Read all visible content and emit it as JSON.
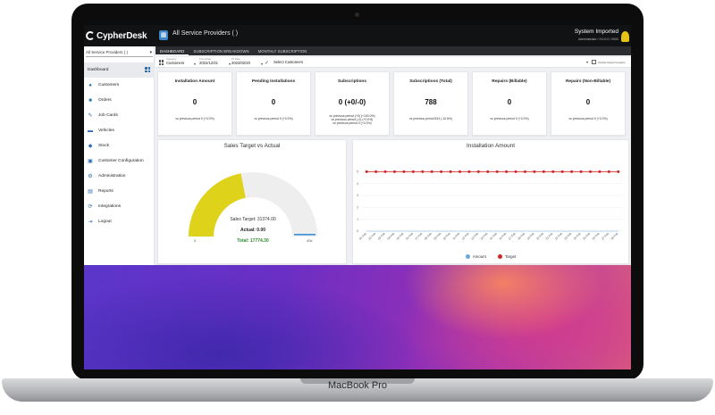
{
  "device": {
    "model_label": "MacBook Pro"
  },
  "topbar": {
    "logo_text": "CypherDesk",
    "service_providers": "All Service Providers ( )",
    "system_status": "System Imported",
    "system_sub": "Administrator / 0.0.0.0 / 0000"
  },
  "sidebar": {
    "selector": "All Service Providers ( )",
    "items": [
      {
        "label": "Dashboard",
        "icon": "dashboard-icon",
        "active": true
      },
      {
        "label": "Customers",
        "icon": "customers-icon"
      },
      {
        "label": "Orders",
        "icon": "orders-icon"
      },
      {
        "label": "Job Cards",
        "icon": "job-cards-icon"
      },
      {
        "label": "Vehicles",
        "icon": "vehicles-icon"
      },
      {
        "label": "Stock",
        "icon": "stock-icon"
      },
      {
        "label": "Customer Configuration",
        "icon": "customer-config-icon"
      },
      {
        "label": "Administration",
        "icon": "administration-icon"
      },
      {
        "label": "Reports",
        "icon": "reports-icon"
      },
      {
        "label": "Integrations",
        "icon": "integrations-icon"
      },
      {
        "label": "Logout",
        "icon": "logout-icon"
      }
    ]
  },
  "tabs": [
    "DASHBOARD",
    "SUBSCRIPTION BREAKDOWN",
    "MONTHLY SUBSCRIPTION"
  ],
  "filters": {
    "category_label": "Category",
    "category_value": "Customers",
    "from_label": "From Date",
    "from_value": "2022/12/31",
    "to_label": "To Date",
    "to_value": "2023/02/20",
    "customer_placeholder": "Select Customers",
    "include_label": "Include Dead Contacts"
  },
  "kpis": [
    {
      "title": "Installation Amount",
      "value": "0",
      "sub": "vs previous period 0 (+0.0%)"
    },
    {
      "title": "Pending Installations",
      "value": "0",
      "sub": "vs previous period 0 (+0.0%)"
    },
    {
      "title": "Subscriptions",
      "value": "0 (+0/-0)",
      "sub": "vs previous period (+0) (+100.0%)\nvs previous period (-0) (+0.0%)\nvs previous period 0 (+0.0%)"
    },
    {
      "title": "Subscriptions (Total)",
      "value": "788",
      "sub": "vs previous period 834 (-10.6%)"
    },
    {
      "title": "Repairs (Billable)",
      "value": "0",
      "sub": "vs previous period 0 (+0.0%)"
    },
    {
      "title": "Repairs (Non-Billable)",
      "value": "0",
      "sub": "vs previous period 0 (+0.0%)"
    }
  ],
  "gauge": {
    "title": "Sales Target vs Actual",
    "target_label": "Sales Target:",
    "target_value": "31374.00",
    "actual_label": "Actual:",
    "actual_value": "0.00",
    "total_label": "Total:",
    "total_value": "17774.30",
    "min_label": "0",
    "max_label": "40k",
    "fill_fraction": 0.44,
    "colors": {
      "fill": "#dfd21a",
      "track": "#eeeeee",
      "marker": "#3a8fd6",
      "total_text": "#2e8b2e"
    }
  },
  "chart_data": {
    "type": "line",
    "title": "Installation Amount",
    "xlabel": "",
    "ylabel": "",
    "x": [
      "01 Feb",
      "02 Feb",
      "03 Feb",
      "04 Feb",
      "05 Feb",
      "06 Feb",
      "07 Feb",
      "08 Feb",
      "09 Feb",
      "10 Feb",
      "11 Feb",
      "12 Feb",
      "13 Feb",
      "14 Feb",
      "15 Feb",
      "16 Feb",
      "17 Feb",
      "18 Feb",
      "19 Feb",
      "20 Feb",
      "21 Feb",
      "22 Feb",
      "23 Feb",
      "24 Feb",
      "25 Feb",
      "26 Feb",
      "27 Feb",
      "28 Feb"
    ],
    "y_ticks": [
      "0",
      "1",
      "2",
      "3",
      "4",
      "5"
    ],
    "ylim": [
      0,
      6
    ],
    "grid": true,
    "legend": "bottom",
    "series": [
      {
        "name": "Amount",
        "color": "#6aa8dc",
        "values": [
          0,
          0,
          0,
          0,
          0,
          0,
          0,
          0,
          0,
          0,
          0,
          0,
          0,
          0,
          0,
          0,
          0,
          0,
          0,
          0,
          0,
          0,
          0,
          0,
          0,
          0,
          0,
          0
        ]
      },
      {
        "name": "Target",
        "color": "#d22525",
        "values": [
          5,
          5,
          5,
          5,
          5,
          5,
          5,
          5,
          5,
          5,
          5,
          5,
          5,
          5,
          5,
          5,
          5,
          5,
          5,
          5,
          5,
          5,
          5,
          5,
          5,
          5,
          5,
          5
        ]
      }
    ]
  }
}
